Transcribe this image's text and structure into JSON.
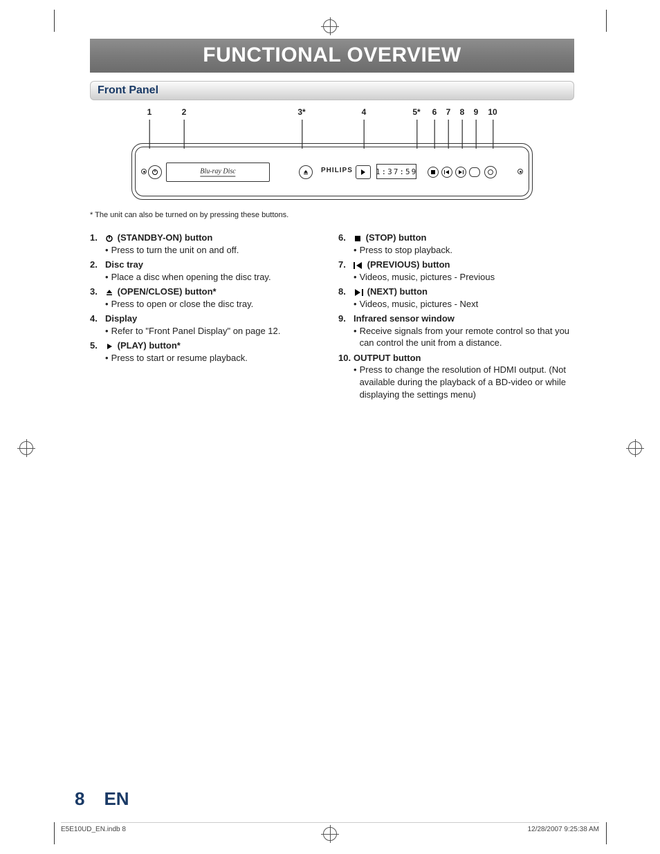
{
  "title": "FUNCTIONAL OVERVIEW",
  "section": "Front Panel",
  "brand_on_device": "PHILIPS",
  "bd_text": "Blu-ray Disc",
  "display_value": "1:37:59",
  "callouts": [
    "1",
    "2",
    "3*",
    "4",
    "5*",
    "6",
    "7",
    "8",
    "9",
    "10"
  ],
  "footnote": "*  The unit can also be turned on by pressing these buttons.",
  "left_list": [
    {
      "n": "1.",
      "icon": "power",
      "label": "(STANDBY-ON) button",
      "desc": [
        "Press to turn the unit on and off."
      ]
    },
    {
      "n": "2.",
      "icon": "",
      "label": "Disc tray",
      "desc": [
        "Place a disc when opening the disc tray."
      ]
    },
    {
      "n": "3.",
      "icon": "eject",
      "label": "(OPEN/CLOSE) button*",
      "desc": [
        "Press to open or close the disc tray."
      ]
    },
    {
      "n": "4.",
      "icon": "",
      "label": "Display",
      "desc": [
        "Refer to \"Front Panel Display\" on page 12."
      ]
    },
    {
      "n": "5.",
      "icon": "play",
      "label": "(PLAY) button*",
      "desc": [
        "Press to start or resume playback."
      ]
    }
  ],
  "right_list": [
    {
      "n": "6.",
      "icon": "stop",
      "label": "(STOP) button",
      "desc": [
        "Press to stop playback."
      ]
    },
    {
      "n": "7.",
      "icon": "prev",
      "label": "(PREVIOUS) button",
      "desc": [
        "Videos, music, pictures - Previous"
      ]
    },
    {
      "n": "8.",
      "icon": "next",
      "label": "(NEXT) button",
      "desc": [
        "Videos, music, pictures - Next"
      ]
    },
    {
      "n": "9.",
      "icon": "",
      "label": "Infrared sensor window",
      "desc": [
        "Receive signals from your remote control so that you can control the unit from a distance."
      ]
    },
    {
      "n": "10.",
      "icon": "",
      "label": "OUTPUT button",
      "desc": [
        "Press to change the resolution of HDMI output. (Not available during the playback of a BD-video or while displaying the settings menu)"
      ]
    }
  ],
  "page_number": "8",
  "lang": "EN",
  "print_file": "E5E10UD_EN.indb   8",
  "print_date": "12/28/2007   9:25:38 AM"
}
